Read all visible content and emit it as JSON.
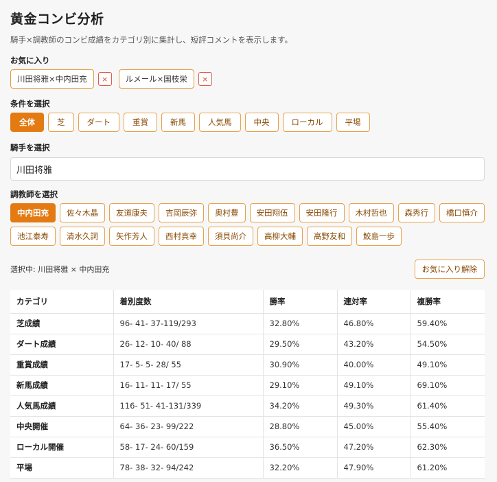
{
  "header": {
    "title": "黄金コンビ分析",
    "subtitle": "騎手×調教師のコンビ成績をカテゴリ別に集計し、短評コメントを表示します。"
  },
  "favorites": {
    "label": "お気に入り",
    "items": [
      "川田将雅×中内田充",
      "ルメール×国枝栄"
    ],
    "remove_symbol": "×"
  },
  "conditions": {
    "label": "条件を選択",
    "items": [
      "全体",
      "芝",
      "ダート",
      "重賞",
      "新馬",
      "人気馬",
      "中央",
      "ローカル",
      "平場"
    ],
    "active": "全体"
  },
  "jockey": {
    "label": "騎手を選択",
    "value": "川田将雅"
  },
  "trainers": {
    "label": "調教師を選択",
    "items": [
      "中内田充",
      "佐々木晶",
      "友道康夫",
      "吉岡辰弥",
      "奥村豊",
      "安田翔伍",
      "安田隆行",
      "木村哲也",
      "森秀行",
      "橋口慎介",
      "池江泰寿",
      "清水久詞",
      "矢作芳人",
      "西村真幸",
      "須貝尚介",
      "高柳大輔",
      "高野友和",
      "鮫島一歩"
    ],
    "active": "中内田充"
  },
  "selection": {
    "text": "選択中: 川田将雅 × 中内田充",
    "unfavorite_label": "お気に入り解除"
  },
  "table": {
    "headers": [
      "カテゴリ",
      "着別度数",
      "勝率",
      "連対率",
      "複勝率"
    ],
    "rows": [
      [
        "芝成績",
        "96- 41- 37-119/293",
        "32.80%",
        "46.80%",
        "59.40%"
      ],
      [
        "ダート成績",
        "26- 12- 10- 40/ 88",
        "29.50%",
        "43.20%",
        "54.50%"
      ],
      [
        "重賞成績",
        "17- 5- 5- 28/ 55",
        "30.90%",
        "40.00%",
        "49.10%"
      ],
      [
        "新馬成績",
        "16- 11- 11- 17/ 55",
        "29.10%",
        "49.10%",
        "69.10%"
      ],
      [
        "人気馬成績",
        "116- 51- 41-131/339",
        "34.20%",
        "49.30%",
        "61.40%"
      ],
      [
        "中央開催",
        "64- 36- 23- 99/222",
        "28.80%",
        "45.00%",
        "55.40%"
      ],
      [
        "ローカル開催",
        "58- 17- 24- 60/159",
        "36.50%",
        "47.20%",
        "62.30%"
      ],
      [
        "平場",
        "78- 38- 32- 94/242",
        "32.20%",
        "47.90%",
        "61.20%"
      ]
    ]
  },
  "colors": {
    "accent": "#e37b12",
    "chip_border": "#e8a24a",
    "remove_red": "#e05b4b"
  }
}
